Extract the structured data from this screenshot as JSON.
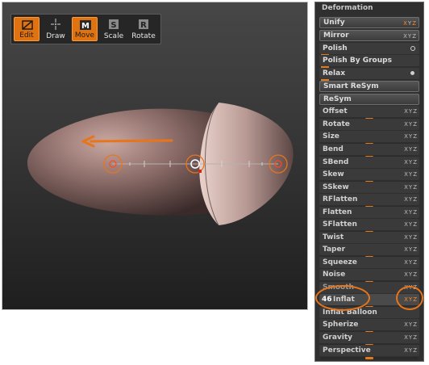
{
  "toolbar": {
    "items": [
      {
        "label": "Edit",
        "icon": "edit-icon",
        "active": true
      },
      {
        "label": "Draw",
        "icon": "draw-icon",
        "active": false
      },
      {
        "label": "Move",
        "icon": "move-icon",
        "active": true,
        "letter": "M"
      },
      {
        "label": "Scale",
        "icon": "scale-icon",
        "active": false,
        "letter": "S"
      },
      {
        "label": "Rotate",
        "icon": "rotate-icon",
        "active": false,
        "letter": "R"
      }
    ]
  },
  "panel": {
    "title": "Deformation",
    "axis": {
      "x": "X",
      "y": "Y",
      "z": "Z"
    },
    "buttons": {
      "unify": "Unify",
      "mirror": "Mirror",
      "polish": "Polish",
      "polish_by_groups": "Polish By Groups",
      "relax": "Relax",
      "smart_resym": "Smart ReSym",
      "resym": "ReSym"
    },
    "sliders": {
      "offset": "Offset",
      "rotate": "Rotate",
      "size": "Size",
      "bend": "Bend",
      "sbend": "SBend",
      "skew": "Skew",
      "sskew": "SSkew",
      "rflatten": "RFlatten",
      "flatten": "Flatten",
      "sflatten": "SFlatten",
      "twist": "Twist",
      "taper": "Taper",
      "squeeze": "Squeeze",
      "noise": "Noise",
      "smooth": "Smooth",
      "inflat": "Inflat",
      "inflat_balloon": "Inflat Balloon",
      "spherize": "Spherize",
      "gravity": "Gravity",
      "perspective": "Perspective"
    },
    "inflat_value": "46"
  },
  "colors": {
    "accent": "#e8751a",
    "panel_bg": "#2f2f2f",
    "viewport_bg": "#3a3a3a",
    "model": "#8a6a66"
  }
}
